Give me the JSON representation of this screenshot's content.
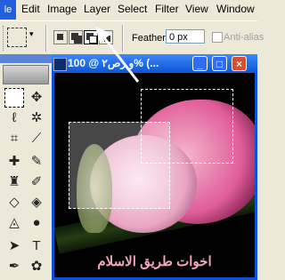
{
  "app_icon_label": "le",
  "menu": [
    "Edit",
    "Image",
    "Layer",
    "Select",
    "Filter",
    "View",
    "Window"
  ],
  "options": {
    "feather_label": "Feather:",
    "feather_value": "0 px",
    "antialias_label": "Anti-alias"
  },
  "document": {
    "title": "و رص٢ @ 100% (...",
    "caption_text": "اخوات طريق الاسلام"
  },
  "window_buttons": {
    "minimize": "_",
    "maximize": "□",
    "close": "×"
  }
}
